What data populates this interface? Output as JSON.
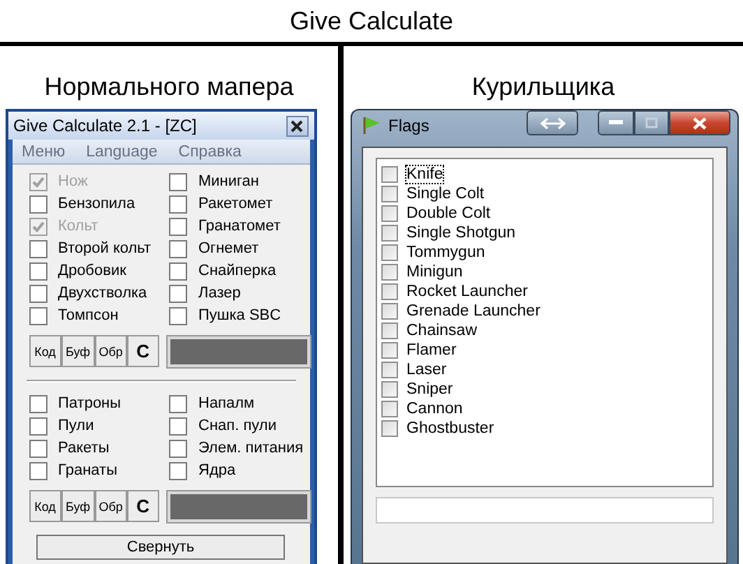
{
  "title": "Give Calculate",
  "left": {
    "caption": "Нормального мапера",
    "window": {
      "title": "Give Calculate 2.1 - [ZC]",
      "menu": [
        "Меню",
        "Language",
        "Справка"
      ],
      "sections": [
        {
          "columns": [
            [
              {
                "label": "Нож",
                "checked": true,
                "disabled": true
              },
              {
                "label": "Бензопила",
                "checked": false,
                "disabled": false
              },
              {
                "label": "Кольт",
                "checked": true,
                "disabled": true
              },
              {
                "label": "Второй кольт",
                "checked": false,
                "disabled": false
              },
              {
                "label": "Дробовик",
                "checked": false,
                "disabled": false
              },
              {
                "label": "Двухстволка",
                "checked": false,
                "disabled": false
              },
              {
                "label": "Томпсон",
                "checked": false,
                "disabled": false
              }
            ],
            [
              {
                "label": "Миниган",
                "checked": false,
                "disabled": false
              },
              {
                "label": "Ракетомет",
                "checked": false,
                "disabled": false
              },
              {
                "label": "Гранатомет",
                "checked": false,
                "disabled": false
              },
              {
                "label": "Огнемет",
                "checked": false,
                "disabled": false
              },
              {
                "label": "Снайперка",
                "checked": false,
                "disabled": false
              },
              {
                "label": "Лазер",
                "checked": false,
                "disabled": false
              },
              {
                "label": "Пушка SBC",
                "checked": false,
                "disabled": false
              }
            ]
          ],
          "buttons": [
            "Код",
            "Буф",
            "Обр",
            "C"
          ]
        },
        {
          "columns": [
            [
              {
                "label": "Патроны",
                "checked": false,
                "disabled": false
              },
              {
                "label": "Пули",
                "checked": false,
                "disabled": false
              },
              {
                "label": "Ракеты",
                "checked": false,
                "disabled": false
              },
              {
                "label": "Гранаты",
                "checked": false,
                "disabled": false
              }
            ],
            [
              {
                "label": "Напалм",
                "checked": false,
                "disabled": false
              },
              {
                "label": "Снап. пули",
                "checked": false,
                "disabled": false
              },
              {
                "label": "Элем. питания",
                "checked": false,
                "disabled": false
              },
              {
                "label": "Ядра",
                "checked": false,
                "disabled": false
              }
            ]
          ],
          "buttons": [
            "Код",
            "Буф",
            "Обр",
            "C"
          ]
        }
      ],
      "collapse_button": "Свернуть"
    }
  },
  "right": {
    "caption": "Курильщика",
    "window": {
      "title": "Flags",
      "flags": [
        {
          "label": "Knife",
          "checked": false,
          "focused": true
        },
        {
          "label": "Single Colt",
          "checked": false,
          "focused": false
        },
        {
          "label": "Double Colt",
          "checked": false,
          "focused": false
        },
        {
          "label": "Single Shotgun",
          "checked": false,
          "focused": false
        },
        {
          "label": "Tommygun",
          "checked": false,
          "focused": false
        },
        {
          "label": "Minigun",
          "checked": false,
          "focused": false
        },
        {
          "label": "Rocket Launcher",
          "checked": false,
          "focused": false
        },
        {
          "label": "Grenade Launcher",
          "checked": false,
          "focused": false
        },
        {
          "label": "Chainsaw",
          "checked": false,
          "focused": false
        },
        {
          "label": "Flamer",
          "checked": false,
          "focused": false
        },
        {
          "label": "Laser",
          "checked": false,
          "focused": false
        },
        {
          "label": "Sniper",
          "checked": false,
          "focused": false
        },
        {
          "label": "Cannon",
          "checked": false,
          "focused": false
        },
        {
          "label": "Ghostbuster",
          "checked": false,
          "focused": false
        }
      ]
    }
  }
}
